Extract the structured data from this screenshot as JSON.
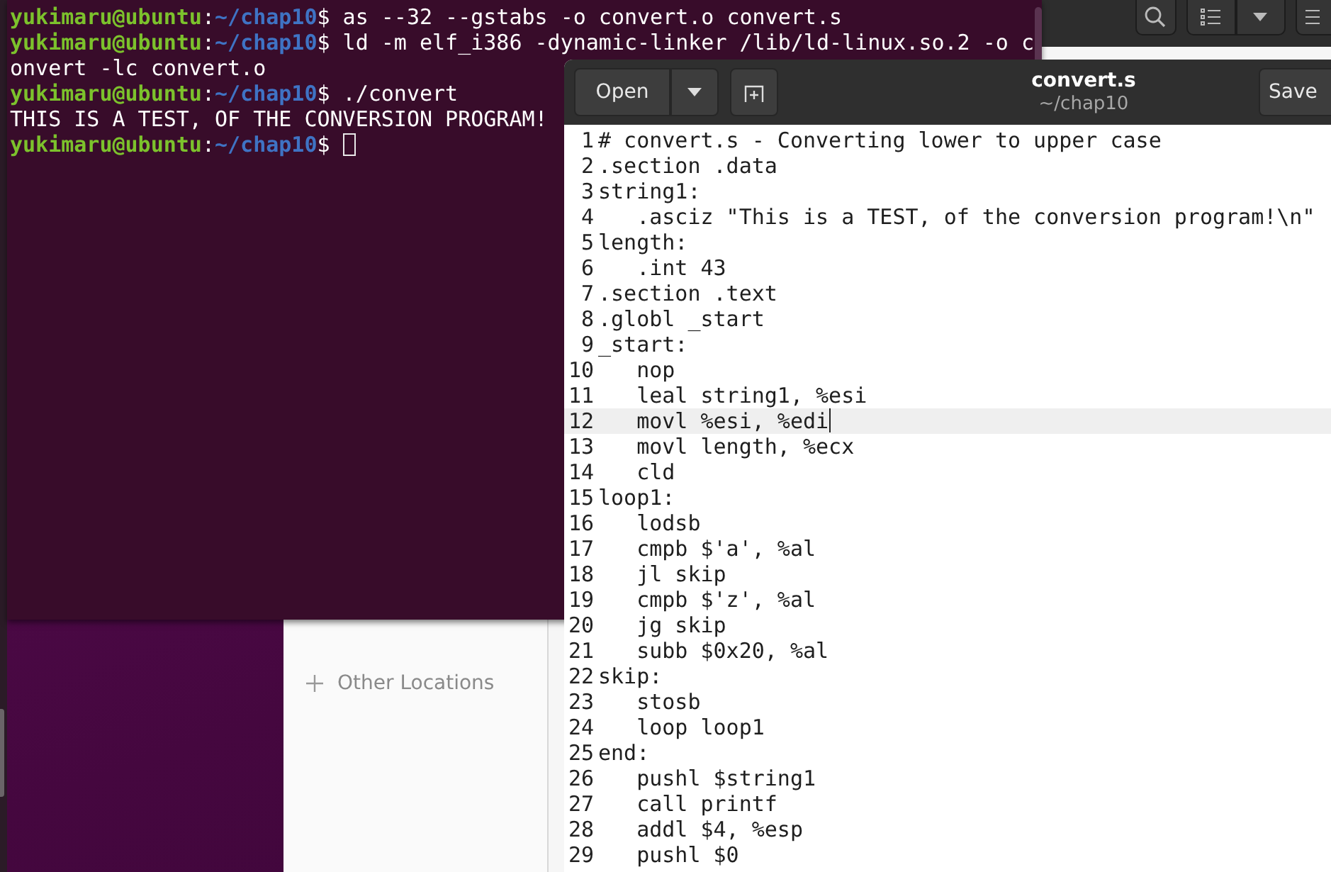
{
  "terminal": {
    "lines": [
      {
        "parts": [
          {
            "kind": "user",
            "text": "yukimaru@ubuntu"
          },
          {
            "kind": "plain",
            "text": ":"
          },
          {
            "kind": "path",
            "text": "~/chap10"
          },
          {
            "kind": "plain",
            "text": "$ as --32 --gstabs -o convert.o convert.s"
          }
        ],
        "cursor": false
      },
      {
        "parts": [
          {
            "kind": "user",
            "text": "yukimaru@ubuntu"
          },
          {
            "kind": "plain",
            "text": ":"
          },
          {
            "kind": "path",
            "text": "~/chap10"
          },
          {
            "kind": "plain",
            "text": "$ ld -m elf_i386 -dynamic-linker /lib/ld-linux.so.2 -o c"
          }
        ],
        "cursor": false
      },
      {
        "parts": [
          {
            "kind": "plain",
            "text": "onvert -lc convert.o"
          }
        ],
        "cursor": false
      },
      {
        "parts": [
          {
            "kind": "user",
            "text": "yukimaru@ubuntu"
          },
          {
            "kind": "plain",
            "text": ":"
          },
          {
            "kind": "path",
            "text": "~/chap10"
          },
          {
            "kind": "plain",
            "text": "$ ./convert"
          }
        ],
        "cursor": false
      },
      {
        "parts": [
          {
            "kind": "plain",
            "text": "THIS IS A TEST, OF THE CONVERSION PROGRAM!"
          }
        ],
        "cursor": false
      },
      {
        "parts": [
          {
            "kind": "user",
            "text": "yukimaru@ubuntu"
          },
          {
            "kind": "plain",
            "text": ":"
          },
          {
            "kind": "path",
            "text": "~/chap10"
          },
          {
            "kind": "plain",
            "text": "$ "
          }
        ],
        "cursor": true
      }
    ]
  },
  "files": {
    "sidebar": {
      "items": [
        {
          "label": "Other Locations"
        }
      ]
    }
  },
  "editor": {
    "open_button": "Open",
    "title": "convert.s",
    "subtitle": "~/chap10",
    "save_button": "Save",
    "lines": [
      {
        "number": "1",
        "text": "# convert.s - Converting lower to upper case",
        "current": false
      },
      {
        "number": "2",
        "text": ".section .data",
        "current": false
      },
      {
        "number": "3",
        "text": "string1:",
        "current": false
      },
      {
        "number": "4",
        "text": "   .asciz \"This is a TEST, of the conversion program!\\n\"",
        "current": false
      },
      {
        "number": "5",
        "text": "length:",
        "current": false
      },
      {
        "number": "6",
        "text": "   .int 43",
        "current": false
      },
      {
        "number": "7",
        "text": ".section .text",
        "current": false
      },
      {
        "number": "8",
        "text": ".globl _start",
        "current": false
      },
      {
        "number": "9",
        "text": "_start:",
        "current": false
      },
      {
        "number": "10",
        "text": "   nop",
        "current": false
      },
      {
        "number": "11",
        "text": "   leal string1, %esi",
        "current": false
      },
      {
        "number": "12",
        "text": "   movl %esi, %edi",
        "current": true
      },
      {
        "number": "13",
        "text": "   movl length, %ecx",
        "current": false
      },
      {
        "number": "14",
        "text": "   cld",
        "current": false
      },
      {
        "number": "15",
        "text": "loop1:",
        "current": false
      },
      {
        "number": "16",
        "text": "   lodsb",
        "current": false
      },
      {
        "number": "17",
        "text": "   cmpb $'a', %al",
        "current": false
      },
      {
        "number": "18",
        "text": "   jl skip",
        "current": false
      },
      {
        "number": "19",
        "text": "   cmpb $'z', %al",
        "current": false
      },
      {
        "number": "20",
        "text": "   jg skip",
        "current": false
      },
      {
        "number": "21",
        "text": "   subb $0x20, %al",
        "current": false
      },
      {
        "number": "22",
        "text": "skip:",
        "current": false
      },
      {
        "number": "23",
        "text": "   stosb",
        "current": false
      },
      {
        "number": "24",
        "text": "   loop loop1",
        "current": false
      },
      {
        "number": "25",
        "text": "end:",
        "current": false
      },
      {
        "number": "26",
        "text": "   pushl $string1",
        "current": false
      },
      {
        "number": "27",
        "text": "   call printf",
        "current": false
      },
      {
        "number": "28",
        "text": "   addl $4, %esp",
        "current": false
      },
      {
        "number": "29",
        "text": "   pushl $0",
        "current": false
      }
    ]
  }
}
